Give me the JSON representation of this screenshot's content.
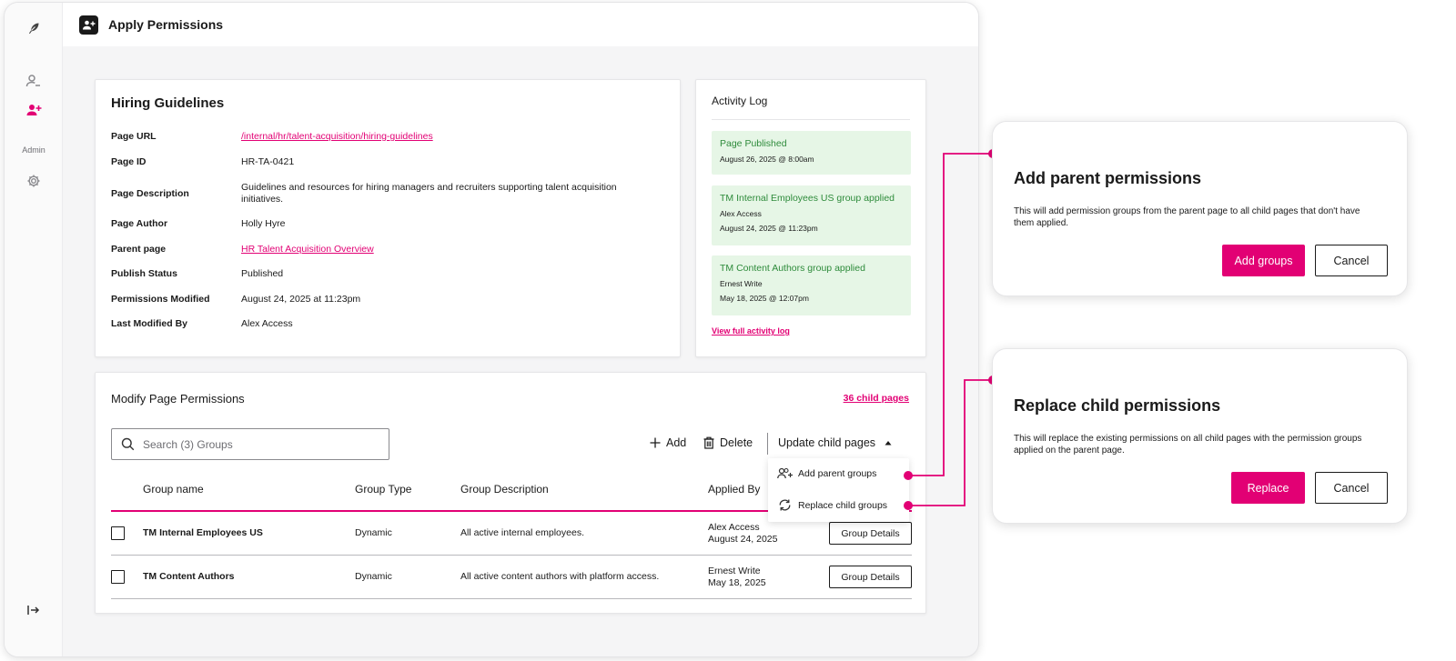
{
  "app": {
    "title": "Apply Permissions",
    "nav": {
      "admin_label": "Admin"
    }
  },
  "details": {
    "title": "Hiring Guidelines",
    "rows": [
      {
        "label": "Page URL",
        "value": "/internal/hr/talent-acquisition/hiring-guidelines"
      },
      {
        "label": "Page ID",
        "value": "HR-TA-0421"
      },
      {
        "label": "Page Description",
        "value": "Guidelines and resources for hiring managers and recruiters supporting talent acquisition initiatives."
      },
      {
        "label": "Page Author",
        "value": "Holly Hyre"
      },
      {
        "label": "Parent page",
        "value": "HR Talent Acquisition Overview"
      },
      {
        "label": "Publish Status",
        "value": "Published"
      },
      {
        "label": "Permissions Modified",
        "value": "August 24, 2025 at 11:23pm"
      },
      {
        "label": "Last Modified By",
        "value": "Alex Access"
      }
    ]
  },
  "activity": {
    "title": "Activity Log",
    "items": [
      {
        "title": "Page Published",
        "user": "",
        "time": "August 26, 2025 @ 8:00am"
      },
      {
        "title": "TM Internal Employees US group applied",
        "user": "Alex Access",
        "time": "August 24, 2025 @ 11:23pm"
      },
      {
        "title": "TM Content Authors group applied",
        "user": "Ernest Write",
        "time": "May 18, 2025 @ 12:07pm"
      }
    ],
    "view_all": "View full activity log"
  },
  "permissions": {
    "title": "Modify Page Permissions",
    "child_pages_link": "36 child pages",
    "search_placeholder": "Search (3) Groups",
    "toolbar": {
      "add": "Add",
      "delete": "Delete",
      "update_child": "Update child pages"
    },
    "columns": [
      "Group name",
      "Group Type",
      "Group Description",
      "Applied By"
    ],
    "rows": [
      {
        "name": "TM Internal Employees US",
        "type": "Dynamic",
        "description": "All active internal employees.",
        "applied_by": "Alex Access",
        "applied_date": "August 24, 2025",
        "button": "Group Details"
      },
      {
        "name": "TM Content Authors",
        "type": "Dynamic",
        "description": "All active content authors with platform access.",
        "applied_by": "Ernest Write",
        "applied_date": "May 18, 2025",
        "button": "Group Details"
      }
    ],
    "dropdown": {
      "add_parent": "Add parent groups",
      "replace_child": "Replace child groups"
    }
  },
  "modals": {
    "add_parent": {
      "title": "Add parent permissions",
      "body": "This will add permission groups from the parent page to all child pages that don't have them applied.",
      "primary": "Add groups",
      "secondary": "Cancel"
    },
    "replace_child": {
      "title": "Replace child permissions",
      "body": "This will replace the existing permissions on all child pages with the permission groups applied on the parent page.",
      "primary": "Replace",
      "secondary": "Cancel"
    }
  },
  "colors": {
    "accent": "#e20074",
    "success_bg": "#e6f6e6",
    "success_text": "#2e8b3b"
  },
  "icons": [
    "feather-logo-icon",
    "user-permissions-icon",
    "add-user-icon",
    "gear-icon",
    "collapse-sidebar-icon",
    "add-person-icon",
    "search-icon",
    "plus-icon",
    "trash-icon",
    "caret-up-icon",
    "sync-icon"
  ]
}
